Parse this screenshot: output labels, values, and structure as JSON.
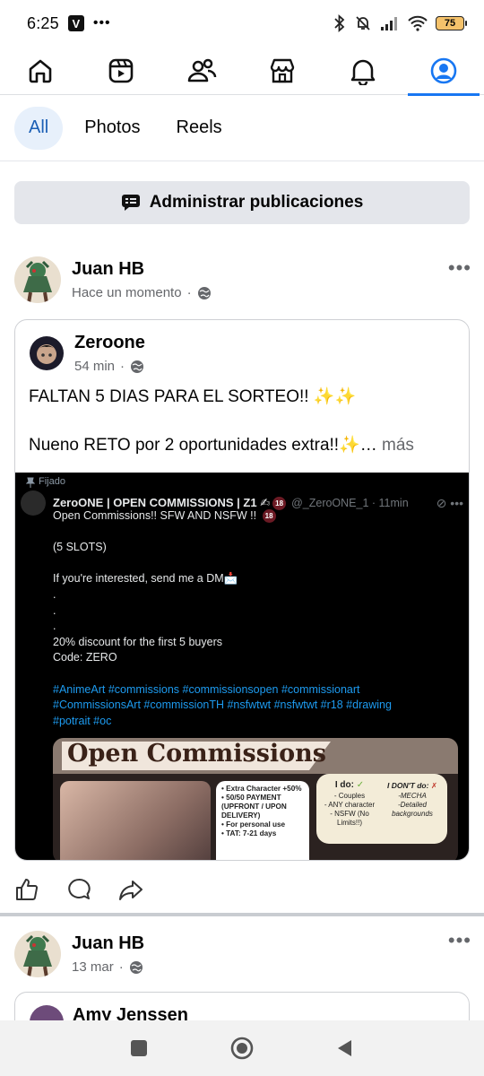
{
  "status_bar": {
    "time": "6:25",
    "app_badge": "V",
    "battery": "75"
  },
  "top_nav": {
    "tabs": [
      {
        "icon": "home-icon"
      },
      {
        "icon": "video-icon"
      },
      {
        "icon": "friends-icon"
      },
      {
        "icon": "marketplace-icon"
      },
      {
        "icon": "notifications-icon"
      },
      {
        "icon": "profile-icon",
        "active": true
      }
    ],
    "accent": "#1877f2"
  },
  "filters": {
    "all": "All",
    "photos": "Photos",
    "reels": "Reels"
  },
  "manage_button": {
    "label": "Administrar publicaciones"
  },
  "post1": {
    "author": "Juan HB",
    "time": "Hace un momento",
    "dot": "·",
    "more": "•••",
    "shared": {
      "author": "Zeroone",
      "time": "54 min",
      "dot": "·",
      "text_line1": "FALTAN 5 DIAS PARA EL SORTEO!! ✨✨",
      "text_line2": "Nueno RETO por 2 oportunidades extra!!✨…",
      "more_link": "más",
      "embedded": {
        "pinned": "Fijado",
        "name": "ZeroONE | OPEN COMMISSIONS | Z1 ✍",
        "badge": "18",
        "handle": "@_ZeroONE_1 · 11min",
        "body": [
          "Open Commissions!! SFW AND NSFW !!",
          "",
          "(5 SLOTS)",
          "",
          "If you're interested, send me a DM📩",
          ".",
          ".",
          ".",
          "20% discount for the first 5 buyers",
          "Code: ZERO"
        ],
        "tags": [
          "#AnimeArt #commissions #commissionsopen #commissionart",
          "#CommissionsArt #commissionTH #nsfwtwt #nsfwtwt #r18 #drawing",
          "#potrait #oc"
        ],
        "image": {
          "title": "Open Commissions",
          "list": [
            "• Extra Character +50%",
            "• 50/50 PAYMENT (UPFRONT / UPON DELIVERY)",
            "• For personal use",
            "• TAT: 7-21 days"
          ],
          "ido_title": "I do:",
          "ido_items": [
            "- Couples",
            "- ANY character",
            "- NSFW (No Limits!!)"
          ],
          "idont_title": "I DON'T do:",
          "idont_items": [
            "-MECHA",
            "-Detailed backgrounds"
          ]
        }
      }
    }
  },
  "post2": {
    "author": "Juan HB",
    "time": "13 mar",
    "dot": "·",
    "more": "•••",
    "shared_author": "Amy Jenssen"
  }
}
